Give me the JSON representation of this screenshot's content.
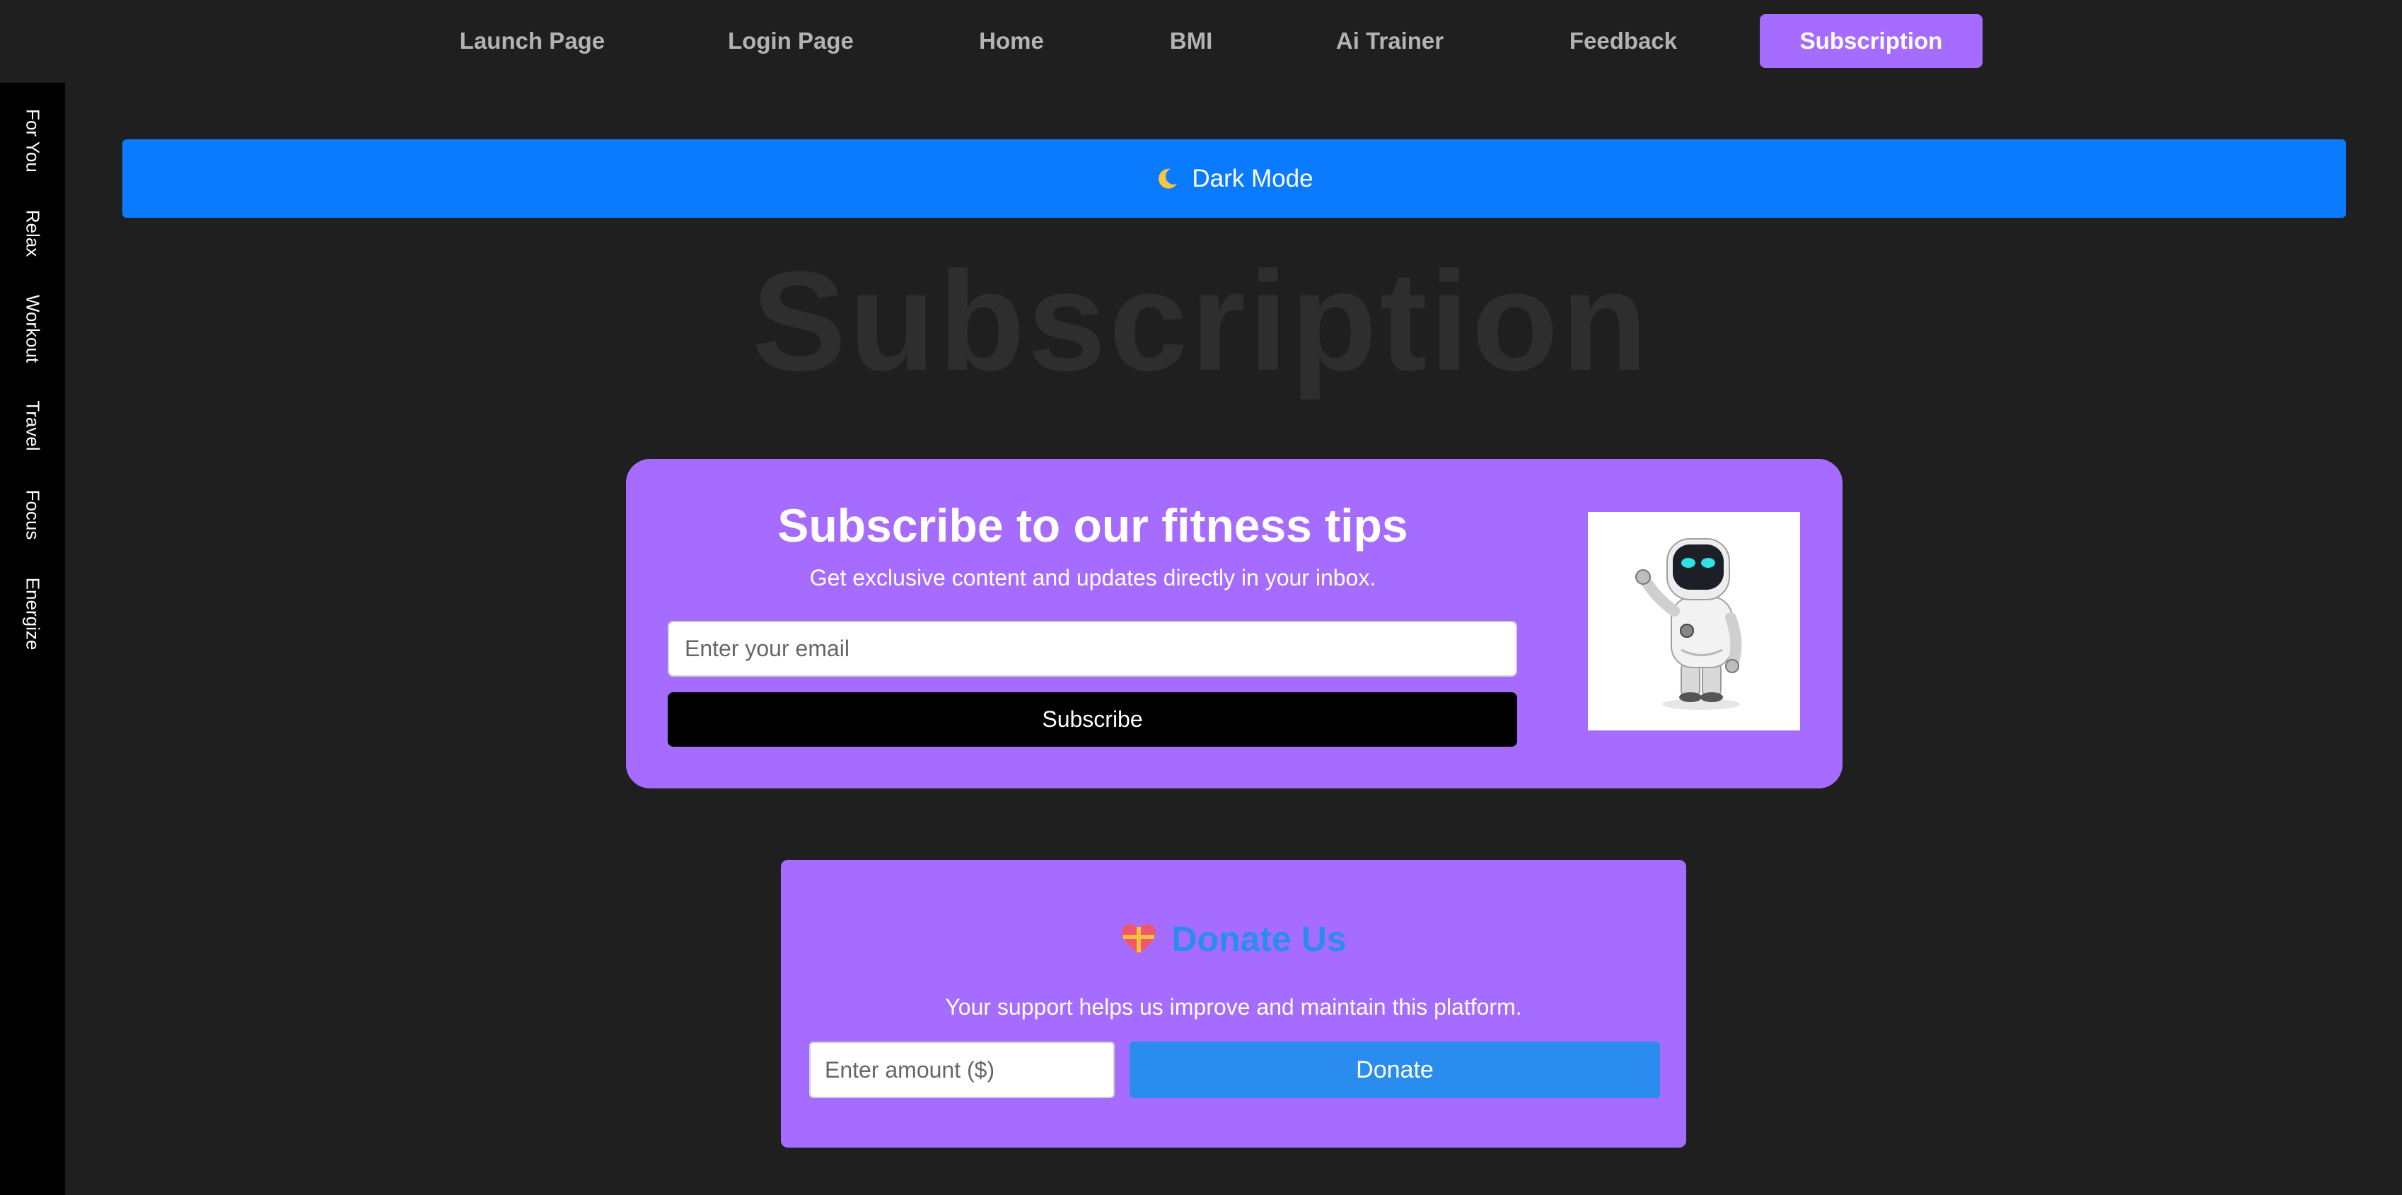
{
  "nav": {
    "items": [
      {
        "label": "Launch Page"
      },
      {
        "label": "Login Page"
      },
      {
        "label": "Home"
      },
      {
        "label": "BMI"
      },
      {
        "label": "Ai Trainer"
      },
      {
        "label": "Feedback"
      },
      {
        "label": "Subscription",
        "active": true
      }
    ]
  },
  "sidebar": {
    "items": [
      {
        "label": "For You"
      },
      {
        "label": "Relax"
      },
      {
        "label": "Workout"
      },
      {
        "label": "Travel"
      },
      {
        "label": "Focus"
      },
      {
        "label": "Energize"
      }
    ]
  },
  "dark_mode": {
    "label": "Dark Mode",
    "icon": "moon-icon"
  },
  "page_title": "Subscription",
  "subscribe": {
    "title": "Subscribe to our fitness tips",
    "description": "Get exclusive content and updates directly in your inbox.",
    "email_placeholder": "Enter your email",
    "button_label": "Subscribe",
    "image": "robot-illustration"
  },
  "donate": {
    "icon": "heart-gift-icon",
    "title": "Donate Us",
    "description": "Your support helps us improve and maintain this platform.",
    "amount_placeholder": "Enter amount ($)",
    "button_label": "Donate"
  },
  "colors": {
    "background": "#1f1f1f",
    "accent_purple": "#a66cff",
    "dark_mode_blue": "#0a7bff",
    "donate_blue": "#2b8cf0",
    "sidebar": "#000000"
  }
}
